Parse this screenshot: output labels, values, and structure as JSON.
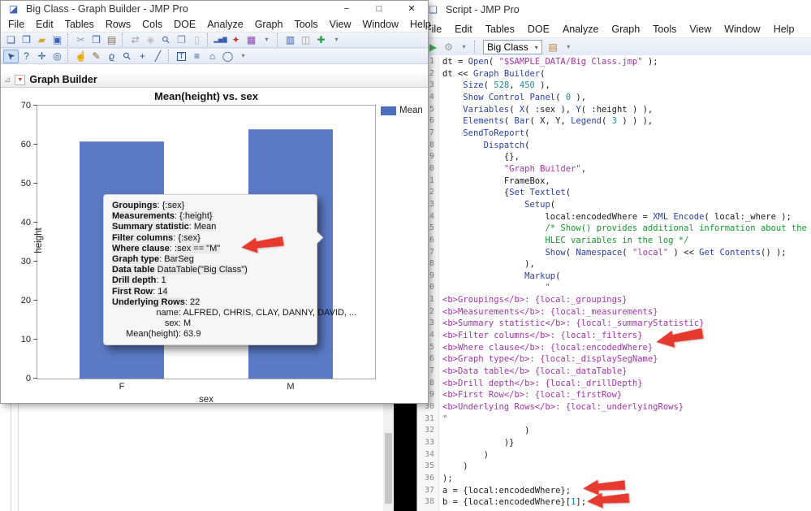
{
  "bg_scrollbar": {
    "name": "background-scrollbar"
  },
  "left_window": {
    "title": "Big Class - Graph Builder - JMP Pro",
    "window_buttons": {
      "minimize": "−",
      "maximize": "□",
      "close": "✕"
    },
    "menus": [
      "File",
      "Edit",
      "Tables",
      "Rows",
      "Cols",
      "DOE",
      "Analyze",
      "Graph",
      "Tools",
      "View",
      "Window",
      "Help"
    ],
    "toolbar_row1": [
      {
        "n": "new-journal-icon",
        "g": "❏",
        "c": "#3b5fb5"
      },
      {
        "n": "new-window-icon",
        "g": "❐",
        "c": "#3b5fb5"
      },
      {
        "n": "open-icon",
        "g": "▰",
        "c": "#d9a62e"
      },
      {
        "n": "save-icon",
        "g": "▣",
        "c": "#3b5fb5"
      },
      {
        "n": "cut-icon",
        "g": "✂",
        "c": "#9a9a9a",
        "sep": true
      },
      {
        "n": "copy-icon",
        "g": "❒",
        "c": "#3b5fb5"
      },
      {
        "n": "paste-icon",
        "g": "▤",
        "c": "#8a6a4a"
      },
      {
        "n": "paste-special-icon",
        "g": "⇄",
        "c": "#9aa0a6",
        "sep": true
      },
      {
        "n": "lock-icon",
        "g": "◈",
        "c": "#b8b8b8"
      },
      {
        "n": "search-icon",
        "g": "⚲",
        "c": "#3b5fb5",
        "rot": -45
      },
      {
        "n": "copy-picture-icon",
        "g": "❒",
        "c": "#6a8ac9"
      },
      {
        "n": "report-icon",
        "g": "▯",
        "c": "#b8b8b8"
      },
      {
        "n": "chart-icon",
        "g": "▂▅▇",
        "c": "#3b5fb5",
        "fs": 7,
        "sep": true
      },
      {
        "n": "doe-icon",
        "g": "✦",
        "c": "#c0392b"
      },
      {
        "n": "colormap-icon",
        "g": "▦",
        "c": "#8e44ad"
      },
      {
        "n": "toolbar-overflow-icon",
        "g": "▾",
        "c": "#6a7a8a",
        "fs": 8
      },
      {
        "n": "journal-icon",
        "g": "▥",
        "c": "#3b5fb5",
        "sep": true
      },
      {
        "n": "compare-icon",
        "g": "◫",
        "c": "#9a9a9a"
      },
      {
        "n": "add-data-icon",
        "g": "✚",
        "c": "#2e9e44"
      },
      {
        "n": "toolbar-overflow2-icon",
        "g": "▾",
        "c": "#6a7a8a",
        "fs": 8
      }
    ],
    "toolbar_row2": [
      {
        "n": "arrow-tool-icon",
        "g": "➤",
        "c": "#2b579a",
        "rot": -135,
        "sel": true
      },
      {
        "n": "help-tool-icon",
        "g": "?",
        "c": "#2b579a"
      },
      {
        "n": "move-tool-icon",
        "g": "✛",
        "c": "#2b579a"
      },
      {
        "n": "bullseye-tool-icon",
        "g": "◎",
        "c": "#2b579a"
      },
      {
        "n": "grabber-tool-icon",
        "g": "☝",
        "c": "#8a6a4a",
        "sep": true
      },
      {
        "n": "brush-tool-icon",
        "g": "✎",
        "c": "#8a5a2e"
      },
      {
        "n": "lasso-tool-icon",
        "g": "ϱ",
        "c": "#2b579a"
      },
      {
        "n": "magnifier-tool-icon",
        "g": "⚲",
        "c": "#2b579a",
        "rot": -45
      },
      {
        "n": "crosshair-tool-icon",
        "g": "+",
        "c": "#2b579a"
      },
      {
        "n": "line-tool-icon",
        "g": "╱",
        "c": "#2b579a"
      },
      {
        "n": "annotate-tool-icon",
        "g": "T",
        "c": "#2b579a",
        "boxed": true,
        "sep": true
      },
      {
        "n": "lines-tool-icon",
        "g": "≡",
        "c": "#2b579a"
      },
      {
        "n": "polygon-tool-icon",
        "g": "⌂",
        "c": "#2b579a"
      },
      {
        "n": "oval-tool-icon",
        "g": "◯",
        "c": "#2b579a"
      },
      {
        "n": "toolbar-overflow3-icon",
        "g": "▾",
        "c": "#6a7a8a",
        "fs": 8
      }
    ],
    "panel": {
      "title": "Graph Builder",
      "red_triangle": "▼",
      "disclosure": "⊿"
    },
    "chart": {
      "type": "bar",
      "title": "Mean(height) vs. sex",
      "categories": [
        "F",
        "M"
      ],
      "values": [
        60.9,
        63.9
      ],
      "xlabel": "sex",
      "ylabel": "height",
      "ylim": [
        0,
        70
      ],
      "yticks": [
        0,
        10,
        20,
        30,
        40,
        50,
        60,
        70
      ],
      "legend": {
        "label": "Mean",
        "color": "#4a70bd"
      },
      "bar_color": "#5b79c6"
    },
    "tooltip": {
      "rows": [
        {
          "label": "Groupings",
          "sep": ": ",
          "value": "{:sex}"
        },
        {
          "label": "Measurements",
          "sep": ": ",
          "value": "{:height}"
        },
        {
          "label": "Summary statistic",
          "sep": ": ",
          "value": "Mean"
        },
        {
          "label": "Filter columns",
          "sep": ": ",
          "value": "{:sex}"
        },
        {
          "label": "Where clause",
          "sep": ": ",
          "value": ":sex == \"M\""
        },
        {
          "label": "Graph type",
          "sep": ": ",
          "value": "BarSeg"
        },
        {
          "label": "Data table",
          "sep": " ",
          "value": "DataTable(\"Big Class\")"
        },
        {
          "label": "Drill depth",
          "sep": ": ",
          "value": "1"
        },
        {
          "label": "First Row",
          "sep": ": ",
          "value": "14"
        },
        {
          "label": "Underlying Rows",
          "sep": ": ",
          "value": "22"
        }
      ],
      "detail_rows": [
        {
          "label": "name",
          "value": "ALFRED, CHRIS, CLAY, DANNY, DAVID, ..."
        },
        {
          "label": "sex",
          "value": "M"
        },
        {
          "label": "Mean(height)",
          "value": "63.9"
        }
      ]
    }
  },
  "script_window": {
    "title": "Script - JMP Pro",
    "menus": [
      "File",
      "Edit",
      "Tables",
      "DOE",
      "Analyze",
      "Graph",
      "Tools",
      "View",
      "Window",
      "Help"
    ],
    "toolbar": {
      "icons_left": [
        {
          "n": "run-script-icon",
          "g": "▶",
          "c": "#3fae49"
        },
        {
          "n": "tools-icon",
          "g": "⚙",
          "c": "#9a9a9a"
        },
        {
          "n": "toolbar-overflow-icon",
          "g": "▾",
          "c": "#6a7a8a",
          "fs": 8
        }
      ],
      "table_selector": "Big Class",
      "selector_caret": "▾",
      "icons_right": [
        {
          "n": "save-to-table-icon",
          "g": "▤",
          "c": "#c77f2e"
        },
        {
          "n": "toolbar-overflow2-icon",
          "g": "▾",
          "c": "#6a7a8a",
          "fs": 8
        }
      ]
    },
    "lines": [
      [
        [
          "p",
          "dt = "
        ],
        [
          "f",
          "Open"
        ],
        [
          "p",
          "( "
        ],
        [
          "s",
          "\"$SAMPLE_DATA/Big Class.jmp\""
        ],
        [
          "p",
          " );"
        ]
      ],
      [
        [
          "p",
          "dt << "
        ],
        [
          "f",
          "Graph Builder"
        ],
        [
          "p",
          "("
        ]
      ],
      [
        [
          "p",
          "    "
        ],
        [
          "f",
          "Size"
        ],
        [
          "p",
          "( "
        ],
        [
          "n",
          "528"
        ],
        [
          "p",
          ", "
        ],
        [
          "n",
          "450"
        ],
        [
          "p",
          " ),"
        ]
      ],
      [
        [
          "p",
          "    "
        ],
        [
          "f",
          "Show Control Panel"
        ],
        [
          "p",
          "( "
        ],
        [
          "n",
          "0"
        ],
        [
          "p",
          " ),"
        ]
      ],
      [
        [
          "p",
          "    "
        ],
        [
          "f",
          "Variables"
        ],
        [
          "p",
          "( "
        ],
        [
          "f",
          "X"
        ],
        [
          "p",
          "( :sex ), "
        ],
        [
          "f",
          "Y"
        ],
        [
          "p",
          "( :height ) ),"
        ]
      ],
      [
        [
          "p",
          "    "
        ],
        [
          "f",
          "Elements"
        ],
        [
          "p",
          "( "
        ],
        [
          "f",
          "Bar"
        ],
        [
          "p",
          "( X, Y, "
        ],
        [
          "f",
          "Legend"
        ],
        [
          "p",
          "( "
        ],
        [
          "n",
          "3"
        ],
        [
          "p",
          " ) ) ),"
        ]
      ],
      [
        [
          "p",
          "    "
        ],
        [
          "f",
          "SendToReport"
        ],
        [
          "p",
          "("
        ]
      ],
      [
        [
          "p",
          "        "
        ],
        [
          "f",
          "Dispatch"
        ],
        [
          "p",
          "("
        ]
      ],
      [
        [
          "p",
          "            {},"
        ]
      ],
      [
        [
          "p",
          "            "
        ],
        [
          "s",
          "\"Graph Builder\""
        ],
        [
          "p",
          ","
        ]
      ],
      [
        [
          "p",
          "            FrameBox,"
        ]
      ],
      [
        [
          "p",
          "            {"
        ],
        [
          "f",
          "Set Textlet"
        ],
        [
          "p",
          "("
        ]
      ],
      [
        [
          "p",
          "                "
        ],
        [
          "f",
          "Setup"
        ],
        [
          "p",
          "("
        ]
      ],
      [
        [
          "p",
          "                    local:encodedWhere = "
        ],
        [
          "f",
          "XML Encode"
        ],
        [
          "p",
          "( local:_where );"
        ]
      ],
      [
        [
          "p",
          "                    "
        ],
        [
          "c",
          "/* Show() provides additional information about the"
        ]
      ],
      [
        [
          "c",
          "                    HLEC variables in the log */"
        ]
      ],
      [
        [
          "p",
          "                    "
        ],
        [
          "f",
          "Show"
        ],
        [
          "p",
          "( "
        ],
        [
          "f",
          "Namespace"
        ],
        [
          "p",
          "( "
        ],
        [
          "s",
          "\"local\""
        ],
        [
          "p",
          " ) << "
        ],
        [
          "f",
          "Get Contents"
        ],
        [
          "p",
          "() );"
        ]
      ],
      [
        [
          "p",
          "                ),"
        ]
      ],
      [
        [
          "p",
          "                "
        ],
        [
          "f",
          "Markup"
        ],
        [
          "p",
          "("
        ]
      ],
      [
        [
          "p",
          "                    "
        ],
        [
          "s",
          "\""
        ]
      ],
      [
        [
          "m",
          "<b>Groupings</b>: {local:_groupings}"
        ]
      ],
      [
        [
          "m",
          "<b>Measurements</b>: {local:_measurements}"
        ]
      ],
      [
        [
          "m",
          "<b>Summary statistic</b>: {local:_summaryStatistic}"
        ]
      ],
      [
        [
          "m",
          "<b>Filter columns</b>: {local:_filters}"
        ]
      ],
      [
        [
          "m",
          "<b>Where clause</b>: {local:encodedWhere}"
        ]
      ],
      [
        [
          "m",
          "<b>Graph type</b>: {local:_displaySegName}"
        ]
      ],
      [
        [
          "m",
          "<b>Data table</b> {local:_dataTable}"
        ]
      ],
      [
        [
          "m",
          "<b>Drill depth</b>: {local:_drillDepth}"
        ]
      ],
      [
        [
          "m",
          "<b>First Row</b>: {local:_firstRow}"
        ]
      ],
      [
        [
          "m",
          "<b>Underlying Rows</b>: {local:_underlyingRows}"
        ]
      ],
      [
        [
          "m",
          "\""
        ]
      ],
      [
        [
          "p",
          "                )"
        ]
      ],
      [
        [
          "p",
          "            )}"
        ]
      ],
      [
        [
          "p",
          "        )"
        ]
      ],
      [
        [
          "p",
          "    )"
        ]
      ],
      [
        [
          "p",
          ");"
        ]
      ],
      [
        [
          "p",
          "a = {local:encodedWhere};"
        ]
      ],
      [
        [
          "p",
          "b = {local:encodedWhere}["
        ],
        [
          "n",
          "1"
        ],
        [
          "p",
          "];"
        ]
      ]
    ]
  },
  "annotations": {
    "arrow_color": "#e8392e"
  }
}
